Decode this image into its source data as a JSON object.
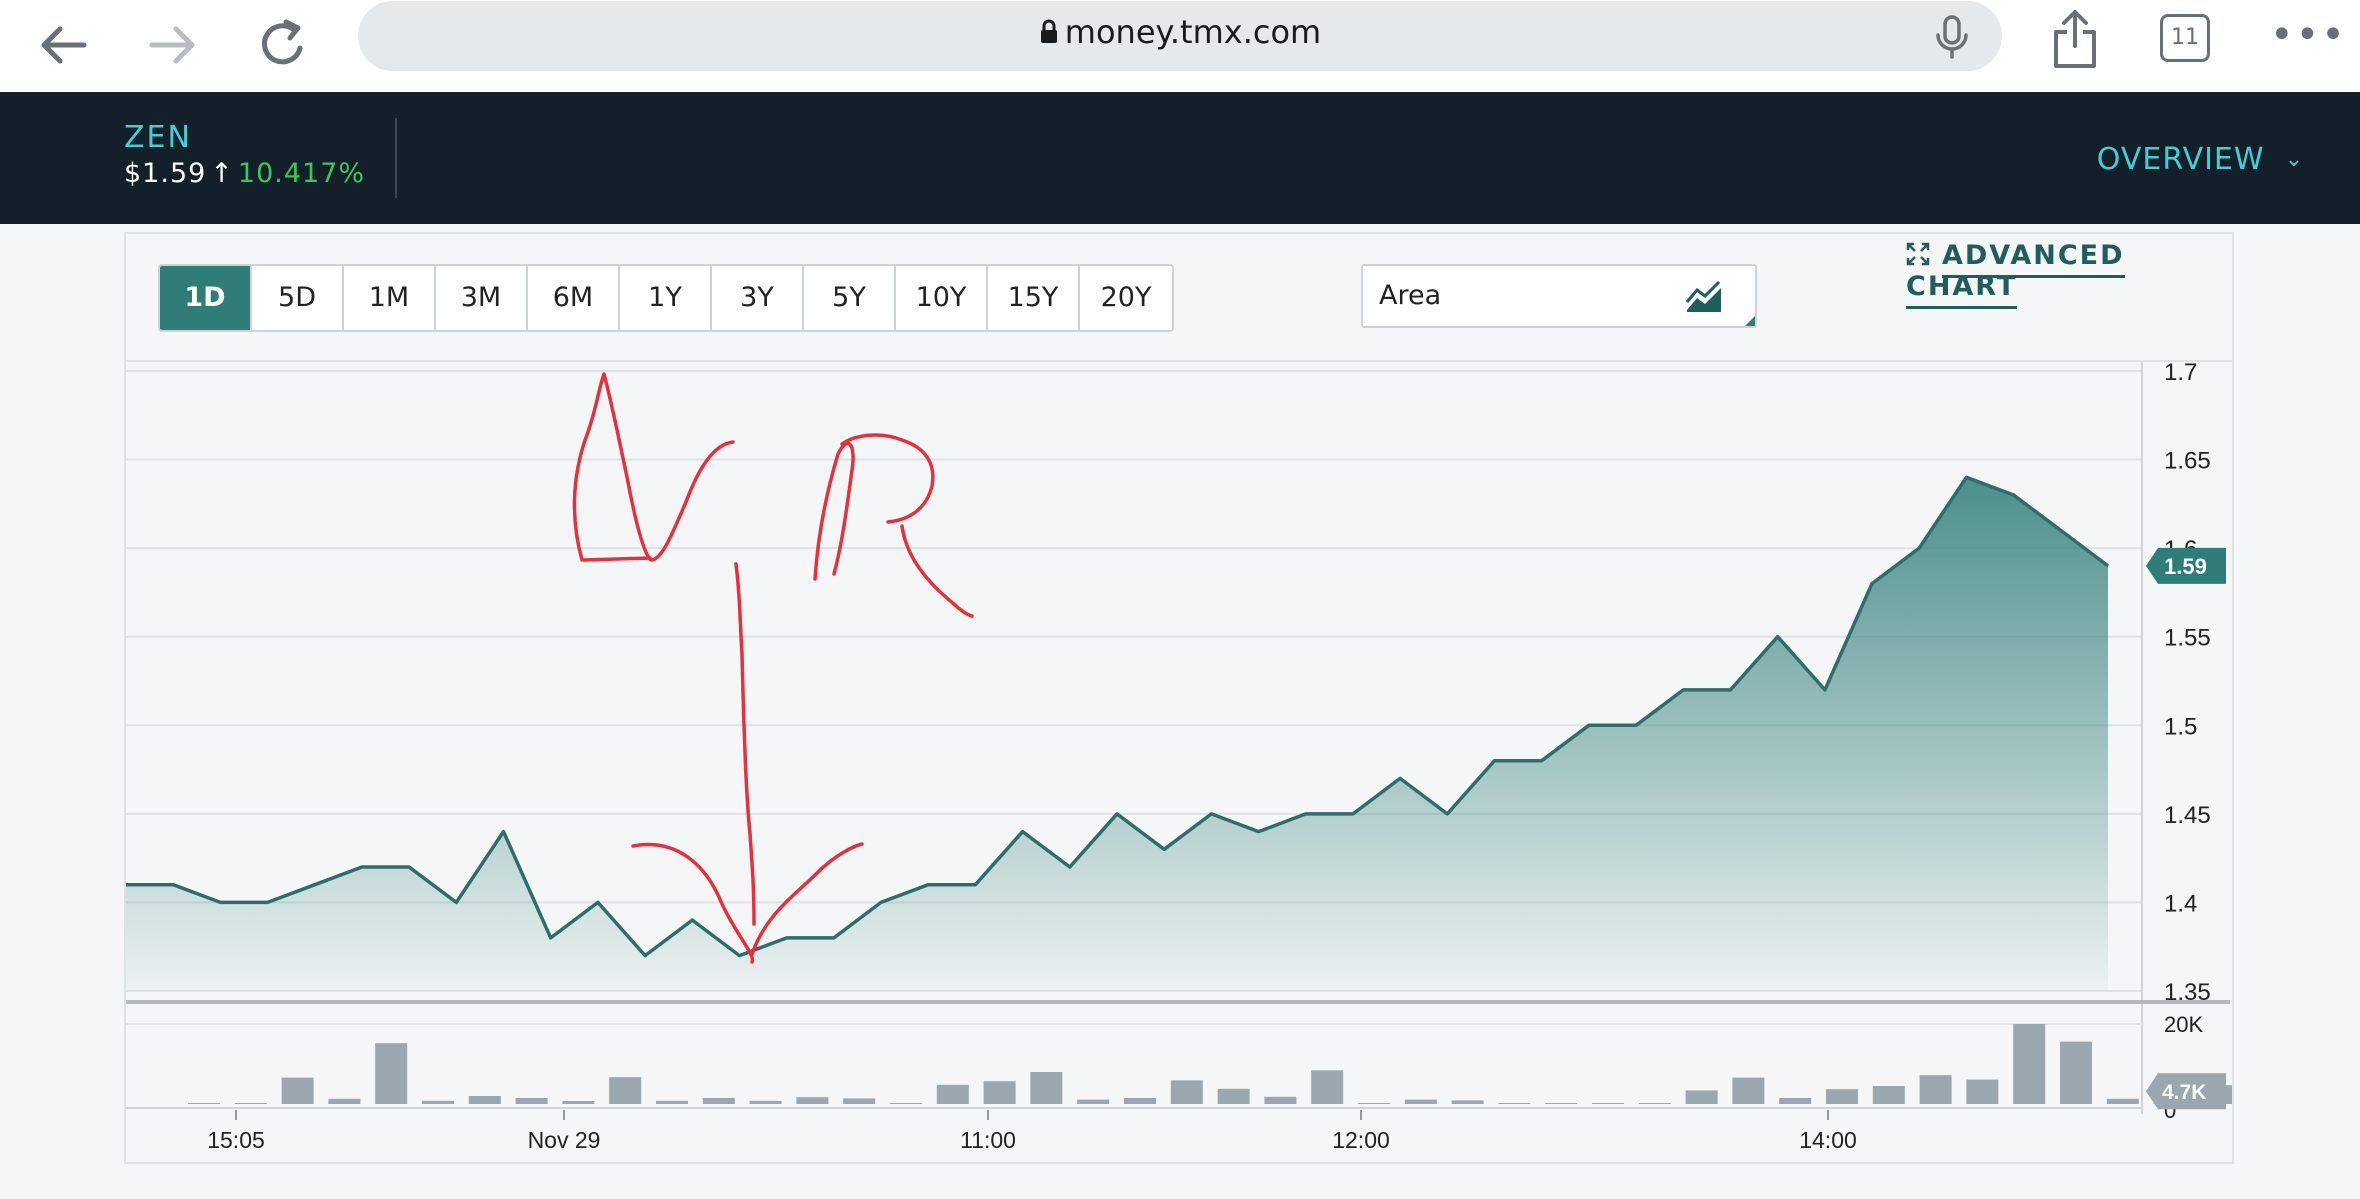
{
  "browser": {
    "url": "money.tmx.com",
    "tab_count": "11"
  },
  "ticker": {
    "symbol": "ZEN",
    "price": "$1.59",
    "change_pct": "10.417%",
    "nav_label": "OVERVIEW"
  },
  "toolbar": {
    "ranges": [
      "1D",
      "5D",
      "1M",
      "3M",
      "6M",
      "1Y",
      "3Y",
      "5Y",
      "10Y",
      "15Y",
      "20Y"
    ],
    "selected_range": "1D",
    "chart_type": "Area",
    "advanced_label": "ADVANCED CHART"
  },
  "colors": {
    "accent": "#2e7d78",
    "header_bg": "#13202a",
    "ticker_cyan": "#3fd0d6",
    "positive": "#3bc55a",
    "volume_bar": "#9aa7ae",
    "annotation": "#e8303d"
  },
  "chart_data": {
    "type": "area",
    "x_tick_labels": [
      "15:05",
      "Nov 29",
      "11:00",
      "12:00",
      "14:00"
    ],
    "price_ylim": [
      1.35,
      1.7
    ],
    "price_ticks": [
      "1.7",
      "1.65",
      "1.6",
      "1.55",
      "1.5",
      "1.45",
      "1.4",
      "1.35"
    ],
    "current_price_label": "1.59",
    "price": [
      1.41,
      1.41,
      1.4,
      1.4,
      1.41,
      1.42,
      1.42,
      1.4,
      1.44,
      1.38,
      1.4,
      1.37,
      1.39,
      1.37,
      1.38,
      1.38,
      1.4,
      1.41,
      1.41,
      1.44,
      1.42,
      1.45,
      1.43,
      1.45,
      1.44,
      1.45,
      1.45,
      1.47,
      1.45,
      1.48,
      1.48,
      1.5,
      1.5,
      1.52,
      1.52,
      1.55,
      1.52,
      1.58,
      1.6,
      1.64,
      1.63,
      1.61,
      1.59
    ],
    "volume_ticks": [
      "20K",
      "0"
    ],
    "volume_ylim": [
      0,
      20000
    ],
    "current_volume_label": "4.7K",
    "volume": [
      0,
      0,
      6600,
      1300,
      15200,
      800,
      2000,
      1500,
      600,
      6700,
      800,
      1500,
      800,
      1700,
      1400,
      0,
      4800,
      5700,
      8000,
      1100,
      1500,
      5900,
      3800,
      1800,
      8400,
      0,
      1100,
      900,
      0,
      0,
      0,
      0,
      3400,
      6600,
      1500,
      3700,
      4500,
      7200,
      6100,
      20000,
      15600,
      1300,
      1300,
      4700
    ]
  }
}
